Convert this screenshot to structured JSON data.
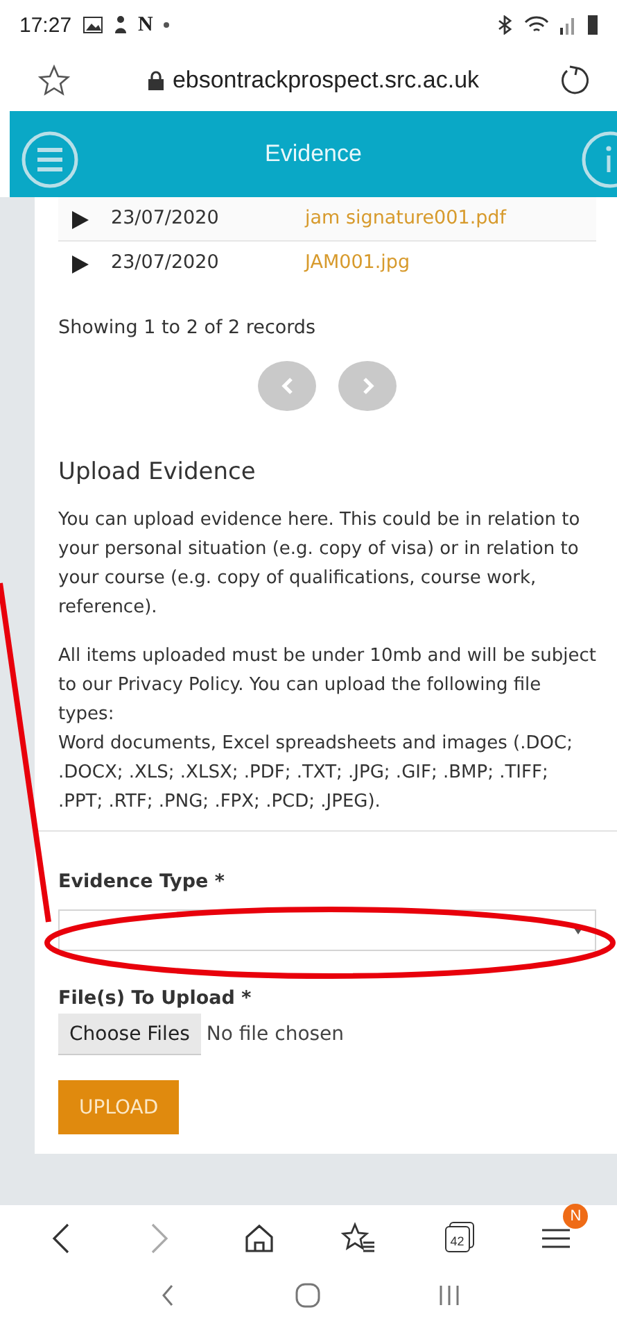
{
  "status_bar": {
    "time": "17:27",
    "notification_letter": "N"
  },
  "browser": {
    "url": "ebsontrackprospect.src.ac.uk",
    "tab_count": "42",
    "menu_badge": "N"
  },
  "header": {
    "title": "Evidence"
  },
  "records": [
    {
      "date": "23/07/2020",
      "file": "jam signature001.pdf"
    },
    {
      "date": "23/07/2020",
      "file": "JAM001.jpg"
    }
  ],
  "records_info": "Showing 1 to 2 of 2 records",
  "pager": [
    {
      "kind": "prev",
      "disabled": true
    },
    {
      "kind": "next",
      "disabled": true
    }
  ],
  "upload": {
    "heading": "Upload Evidence",
    "paragraphs": [
      {
        "lines": [
          "You can upload evidence here.  This could be in relation to your personal situation (e.g. copy of visa) or in relation to your course (e.g. copy of qualifications, course work, reference)."
        ]
      },
      {
        "lines": [
          "All items uploaded must be under 10mb and will be subject to our Privacy Policy. You can upload the following file types:",
          "Word documents, Excel spreadsheets and images (.DOC; .DOCX; .XLS; .XLSX; .PDF; .TXT; .JPG; .GIF; .BMP; .TIFF; .PPT; .RTF; .PNG; .FPX; .PCD; .JPEG)."
        ]
      }
    ],
    "evidence_type_label": "Evidence Type *",
    "files_label": "File(s) To Upload *",
    "choose_button": "Choose Files",
    "file_status": "No file chosen",
    "upload_button": "UPLOAD"
  }
}
